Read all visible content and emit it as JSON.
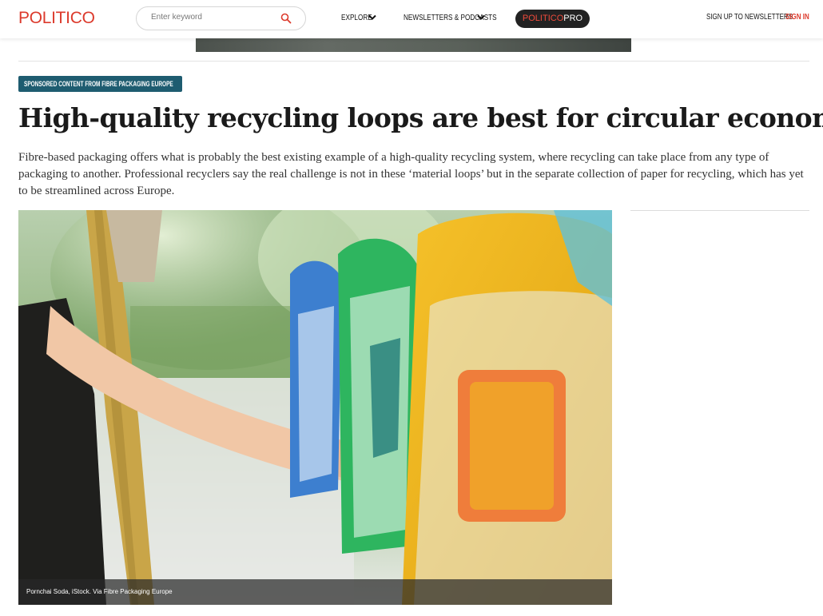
{
  "header": {
    "logo": "POLITICO",
    "search_placeholder": "Enter keyword",
    "nav": {
      "explore": "EXPLORE",
      "newsletters": "NEWSLETTERS & PODCASTS",
      "pro_part1": "POLITICO",
      "pro_part2": "PRO"
    },
    "signup": "SIGN UP TO NEWSLETTERS",
    "signin": "SIGN IN"
  },
  "article": {
    "sponsor_badge": "SPONSORED CONTENT FROM FIBRE PACKAGING EUROPE",
    "headline": "High-quality recycling loops are best for circular economy",
    "dek": "Fibre-based packaging offers what is probably the best existing example of a high-quality recycling system, where recycling can take place from any type of packaging to another. Professional recyclers say the real challenge is not in these ‘material loops’ but in the separate collection of paper for recycling, which has yet to be streamlined across Europe.",
    "image_caption": "Pornchai Soda, iStock. Via Fibre Packaging Europe"
  },
  "colors": {
    "brand_red": "#dc3a2c",
    "badge_teal": "#1e5c70",
    "pro_dark": "#222222"
  },
  "icons": {
    "search": "search-icon",
    "chevron": "chevron-down-icon"
  }
}
